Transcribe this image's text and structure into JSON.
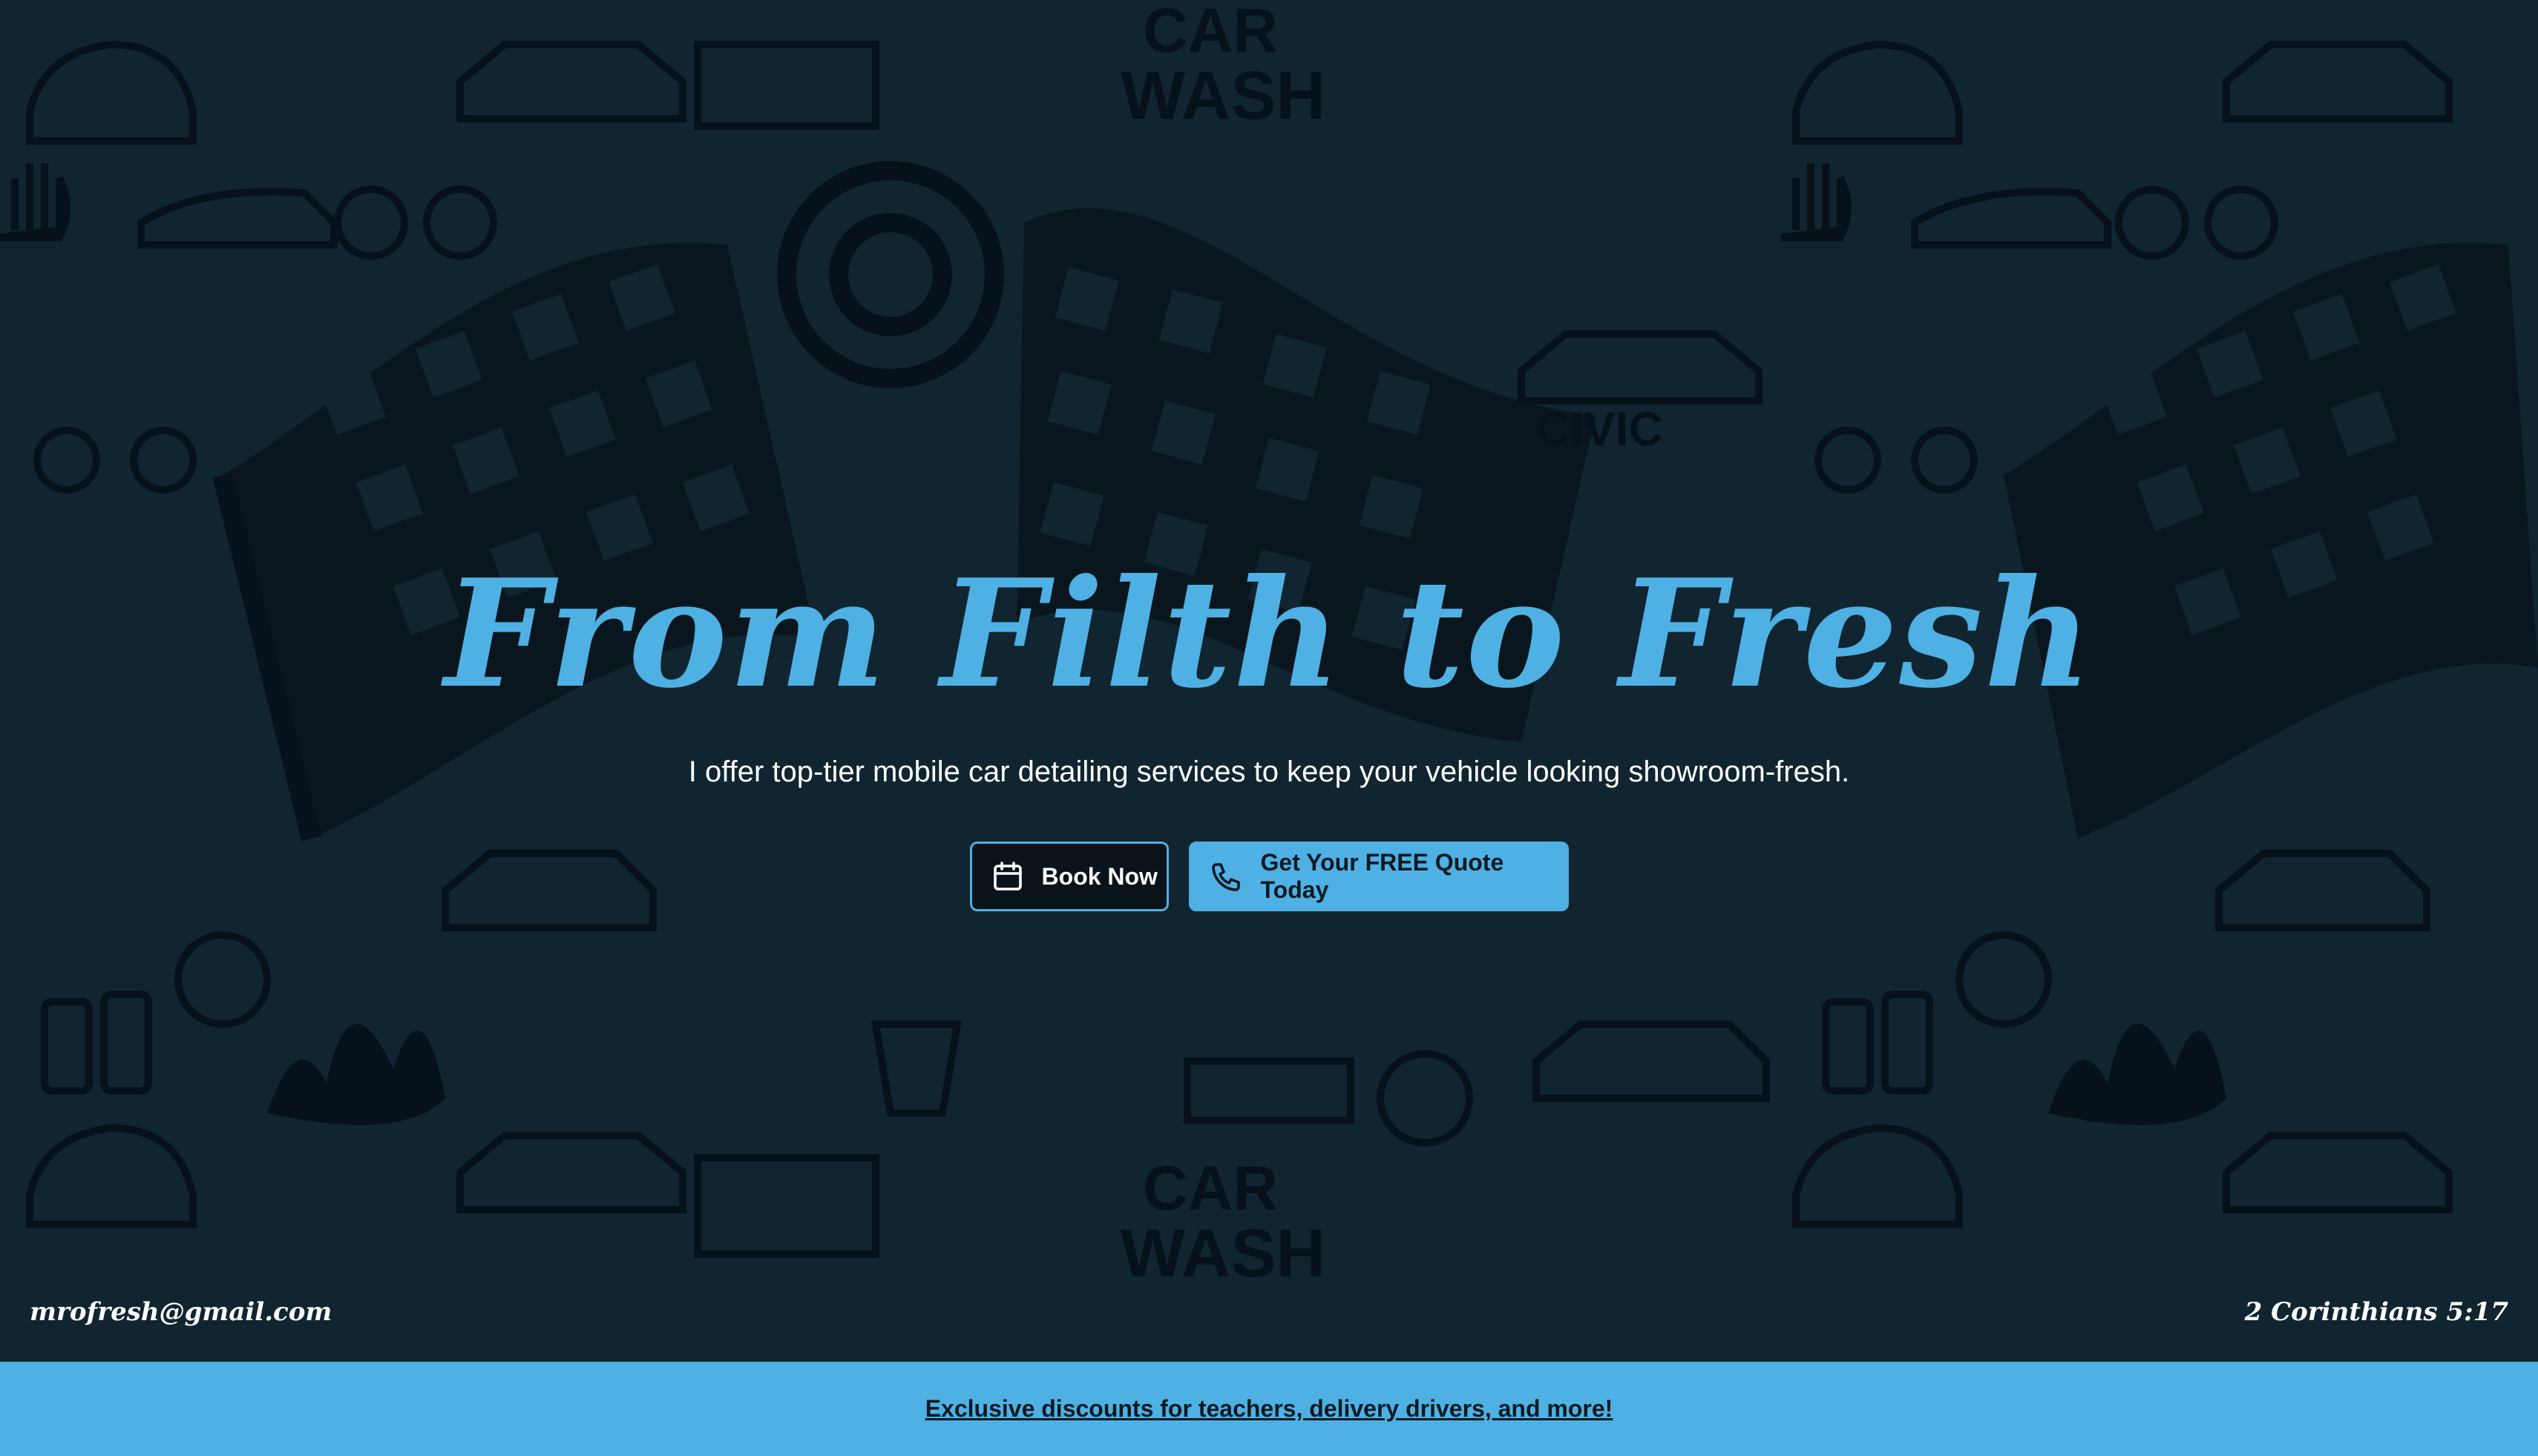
{
  "colors": {
    "accent": "#4fb0e3",
    "background": "#102530",
    "dark_button": "#0a131a",
    "text_dark": "#0b1a22",
    "text_light": "#ffffff"
  },
  "hero": {
    "title": "From Filth to Fresh",
    "subtitle": "I offer top-tier mobile car detailing services to keep your vehicle looking showroom-fresh."
  },
  "cta": {
    "book": {
      "label": "Book Now",
      "icon": "calendar-icon"
    },
    "quote": {
      "label": "Get Your FREE Quote Today",
      "icon": "phone-icon"
    }
  },
  "footer": {
    "email": "mrofresh@gmail.com",
    "verse": "2 Corinthians 5:17"
  },
  "promo": {
    "link_label": "Exclusive discounts for teachers, delivery drivers, and more!"
  },
  "background_art": {
    "text_marks": [
      "CAR",
      "WASH",
      "CIVIC"
    ]
  }
}
